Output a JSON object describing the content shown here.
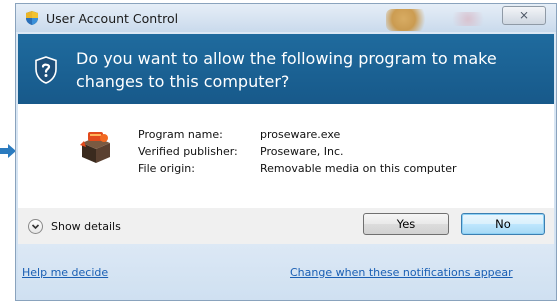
{
  "window": {
    "title": "User Account Control",
    "close_glyph": "☒"
  },
  "header": {
    "question": "Do you want to allow the following program to make changes to this computer?"
  },
  "program_info": {
    "name_label": "Program name:",
    "name_value": "proseware.exe",
    "publisher_label": "Verified publisher:",
    "publisher_value": "Proseware, Inc.",
    "origin_label": "File origin:",
    "origin_value": "Removable media on this computer"
  },
  "actions": {
    "show_details": "Show details",
    "yes": "Yes",
    "no": "No"
  },
  "links": {
    "help": "Help me decide",
    "change": "Change when these notifications appear"
  },
  "colors": {
    "header_blue": "#1f6b9e",
    "link_blue": "#1a5fb4",
    "left_arrow": "#2b7bbf"
  },
  "icons": {
    "title": "uac-shield-icon",
    "header": "question-shield-icon",
    "program": "program-box-icon",
    "details": "chevron-down-circle-icon",
    "left": "pointer-arrow-icon"
  }
}
